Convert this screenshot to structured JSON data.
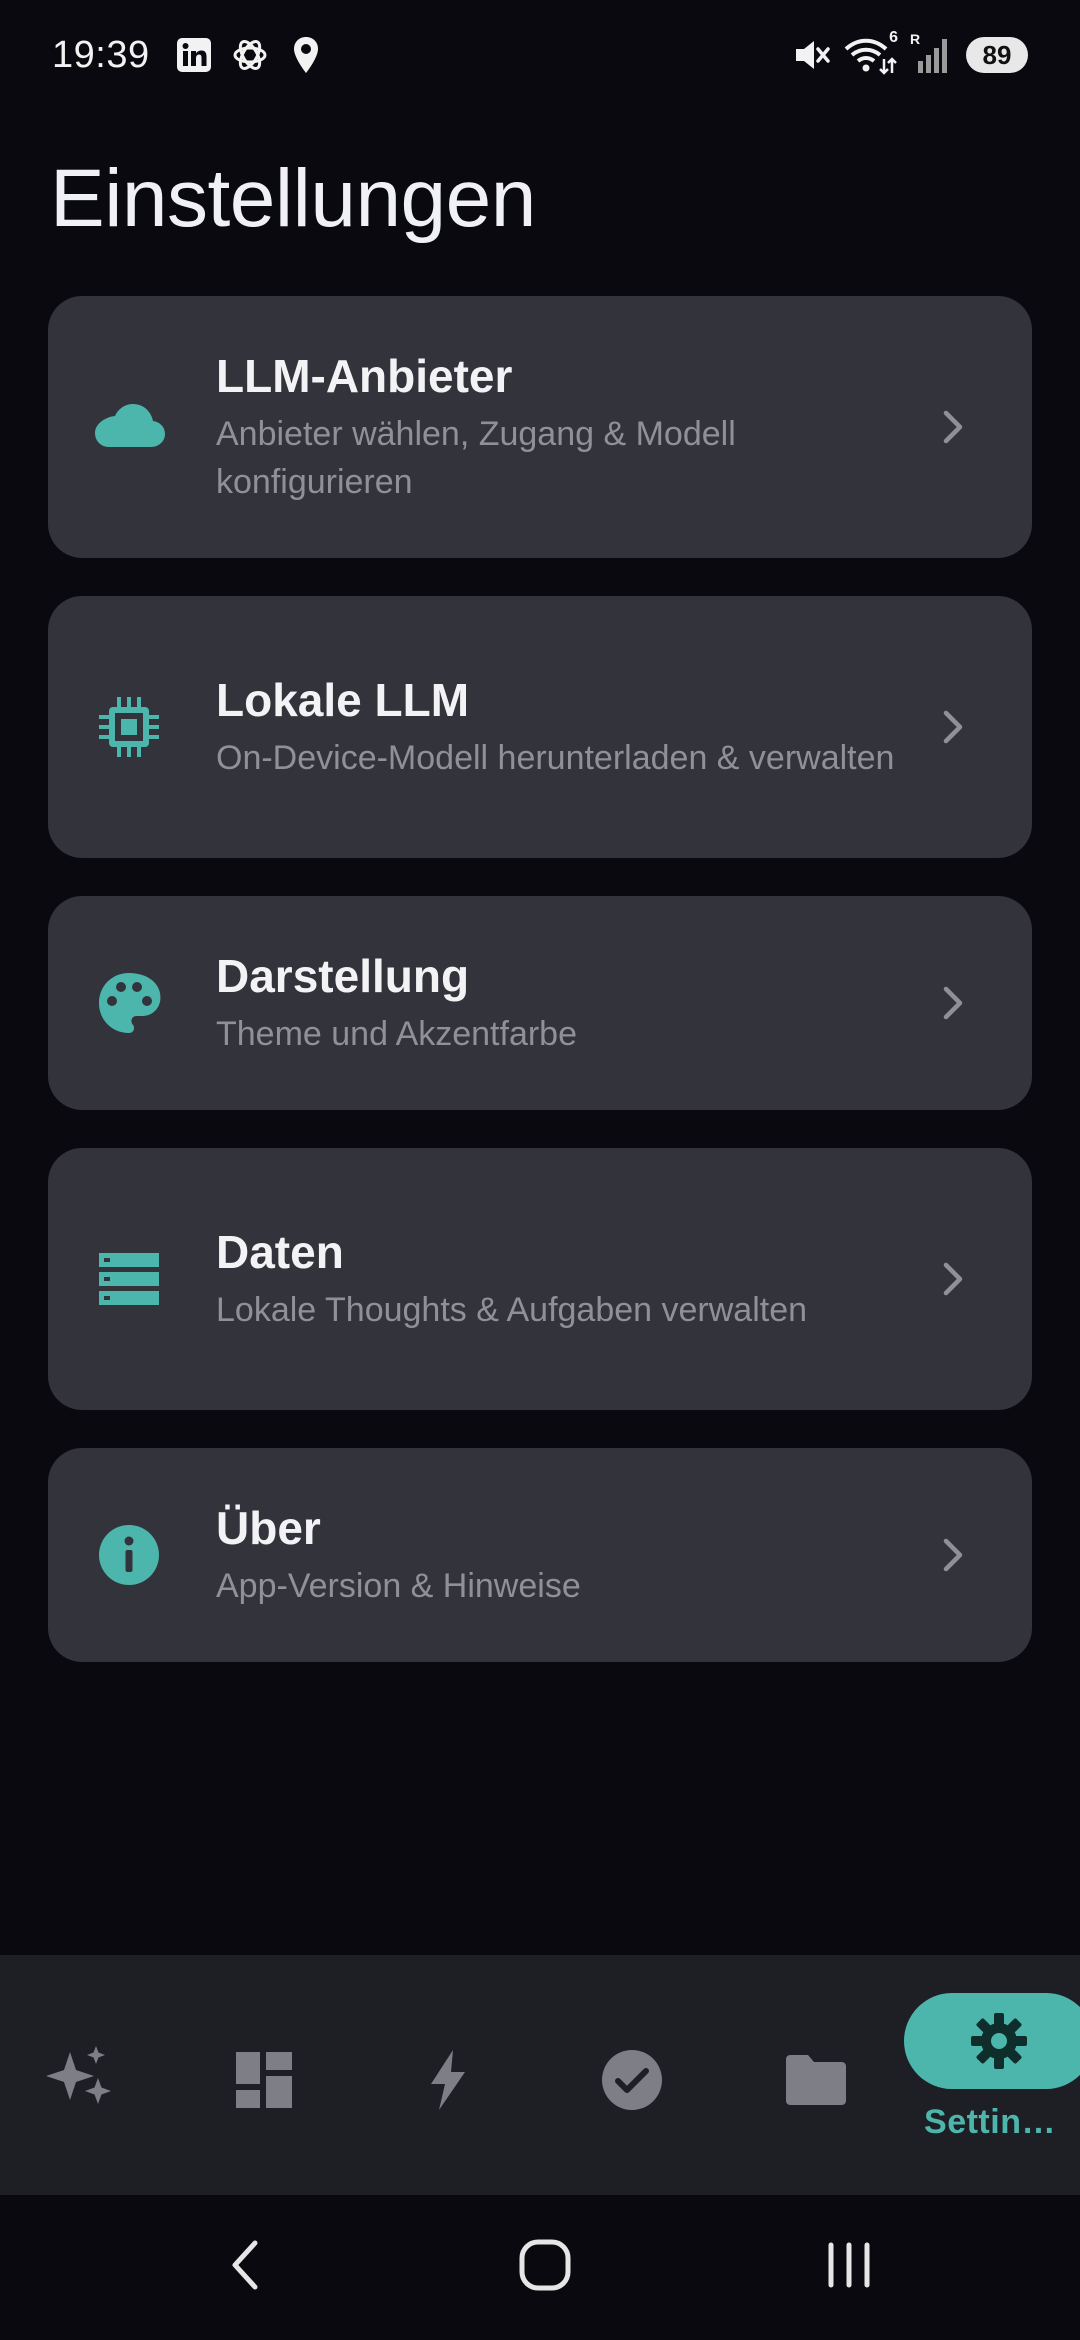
{
  "status_bar": {
    "time": "19:39",
    "battery": "89",
    "left_icons": [
      "linkedin-icon",
      "openai-icon",
      "location-pin-icon"
    ],
    "right_icons": [
      "mute-icon",
      "wifi-icon",
      "signal-icon"
    ],
    "wifi_badge": "6",
    "roaming_badge": "R"
  },
  "page": {
    "title": "Einstellungen"
  },
  "settings": [
    {
      "icon": "cloud-icon",
      "title": "LLM-Anbieter",
      "subtitle": "Anbieter wählen, Zugang & Modell konfigurieren"
    },
    {
      "icon": "chip-icon",
      "title": "Lokale LLM",
      "subtitle": "On-Device-Modell herunterladen & verwalten"
    },
    {
      "icon": "palette-icon",
      "title": "Darstellung",
      "subtitle": "Theme und Akzentfarbe"
    },
    {
      "icon": "storage-icon",
      "title": "Daten",
      "subtitle": "Lokale Thoughts & Aufgaben verwalten"
    },
    {
      "icon": "info-icon",
      "title": "Über",
      "subtitle": "App-Version & Hinweise"
    }
  ],
  "bottom_nav": {
    "items": [
      {
        "icon": "sparkles-icon"
      },
      {
        "icon": "dashboard-icon"
      },
      {
        "icon": "bolt-icon"
      },
      {
        "icon": "check-circle-icon"
      },
      {
        "icon": "folder-icon"
      },
      {
        "icon": "gear-icon",
        "label": "Settin…",
        "active": true
      }
    ]
  },
  "system_nav": [
    "back-icon",
    "home-icon",
    "recents-icon"
  ],
  "colors": {
    "background": "#09090f",
    "card": "#33333b",
    "accent": "#4db6ac",
    "nav_background": "#1e1e25",
    "subtitle": "#8f9099"
  }
}
